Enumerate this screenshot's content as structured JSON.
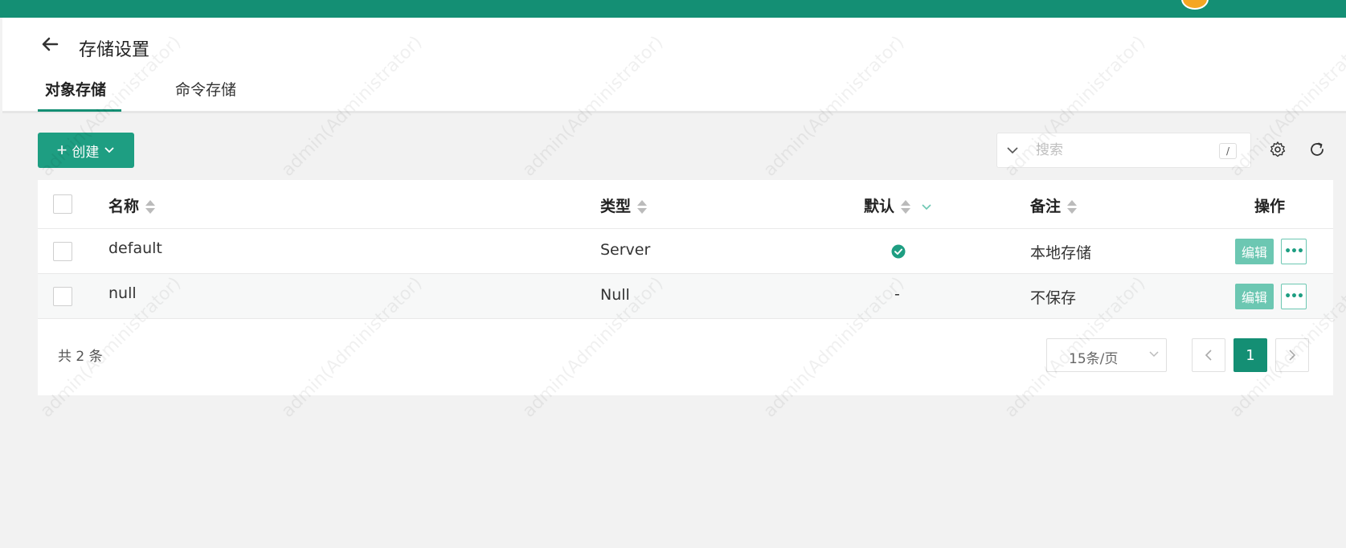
{
  "header": {
    "title": "存储设置",
    "tabs": [
      {
        "label": "对象存储",
        "active": true
      },
      {
        "label": "命令存储",
        "active": false
      }
    ]
  },
  "toolbar": {
    "create_label": "创建",
    "search_placeholder": "搜索",
    "search_shortcut": "/"
  },
  "table": {
    "columns": [
      "名称",
      "类型",
      "默认",
      "备注",
      "操作"
    ],
    "rows": [
      {
        "name": "default",
        "type": "Server",
        "default": "check",
        "remark": "本地存储",
        "edit_label": "编辑",
        "more_label": "•••"
      },
      {
        "name": "null",
        "type": "Null",
        "default": "-",
        "remark": "不保存",
        "edit_label": "编辑",
        "more_label": "•••"
      }
    ]
  },
  "pagination": {
    "total_text": "共 2 条",
    "page_size": "15条/页",
    "current_page": "1"
  },
  "watermark": "admin(Administrator)",
  "colors": {
    "brand": "#148f74",
    "button": "#1e9e82",
    "edit": "#6cc7b2"
  }
}
